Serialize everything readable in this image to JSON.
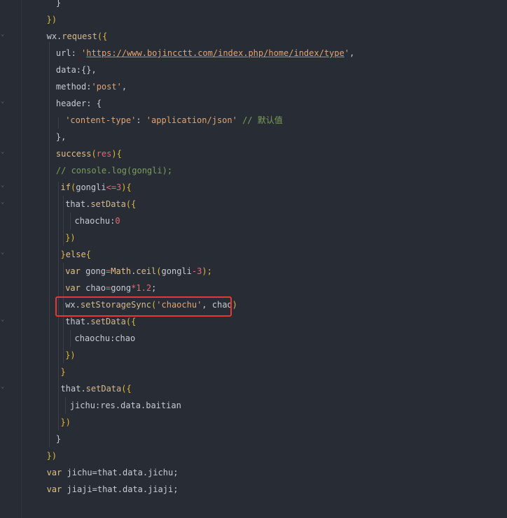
{
  "editor": {
    "language": "javascript",
    "highlight_color": "#e53935",
    "lines": [
      {
        "indent": 3,
        "tokens": [
          {
            "t": "}",
            "c": "pl"
          }
        ]
      },
      {
        "indent": 2,
        "tokens": [
          {
            "t": "})",
            "c": "br"
          }
        ]
      },
      {
        "indent": 2,
        "tokens": [
          {
            "t": "wx.",
            "c": "pl"
          },
          {
            "t": "request",
            "c": "fn"
          },
          {
            "t": "({",
            "c": "br"
          }
        ]
      },
      {
        "indent": 3,
        "tokens": [
          {
            "t": "url",
            "c": "pl"
          },
          {
            "t": ": ",
            "c": "pl"
          },
          {
            "t": "'",
            "c": "str"
          },
          {
            "t": "https://www.bojincctt.com/index.php/home/index/type",
            "c": "url"
          },
          {
            "t": "'",
            "c": "str"
          },
          {
            "t": ",",
            "c": "pl"
          }
        ]
      },
      {
        "indent": 3,
        "tokens": [
          {
            "t": "data",
            "c": "pl"
          },
          {
            "t": ":{},",
            "c": "pl"
          }
        ]
      },
      {
        "indent": 3,
        "tokens": [
          {
            "t": "method",
            "c": "pl"
          },
          {
            "t": ":",
            "c": "pl"
          },
          {
            "t": "'post'",
            "c": "str"
          },
          {
            "t": ",",
            "c": "pl"
          }
        ]
      },
      {
        "indent": 3,
        "tokens": [
          {
            "t": "header",
            "c": "pl"
          },
          {
            "t": ": {",
            "c": "pl"
          }
        ]
      },
      {
        "indent": 4,
        "tokens": [
          {
            "t": "'content-type'",
            "c": "str"
          },
          {
            "t": ": ",
            "c": "pl"
          },
          {
            "t": "'application/json'",
            "c": "str"
          },
          {
            "t": " ",
            "c": "pl"
          },
          {
            "t": "// 默认值",
            "c": "com"
          }
        ]
      },
      {
        "indent": 3,
        "tokens": [
          {
            "t": "},",
            "c": "pl"
          }
        ]
      },
      {
        "indent": 3,
        "tokens": [
          {
            "t": "success",
            "c": "kw"
          },
          {
            "t": "(",
            "c": "br"
          },
          {
            "t": "res",
            "c": "op"
          },
          {
            "t": "){",
            "c": "br"
          }
        ]
      },
      {
        "indent": 3,
        "tokens": [
          {
            "t": "// console.log(gongli);",
            "c": "com"
          }
        ]
      },
      {
        "indent": 3.5,
        "tokens": [
          {
            "t": "if",
            "c": "kw"
          },
          {
            "t": "(",
            "c": "br"
          },
          {
            "t": "gongli",
            "c": "pl"
          },
          {
            "t": "<=",
            "c": "op"
          },
          {
            "t": "3",
            "c": "num"
          },
          {
            "t": "){",
            "c": "br"
          }
        ]
      },
      {
        "indent": 4,
        "tokens": [
          {
            "t": "that.",
            "c": "pl"
          },
          {
            "t": "setData",
            "c": "fn"
          },
          {
            "t": "({",
            "c": "br"
          }
        ]
      },
      {
        "indent": 5,
        "tokens": [
          {
            "t": "chaochu",
            "c": "pl"
          },
          {
            "t": ":",
            "c": "pl"
          },
          {
            "t": "0",
            "c": "num"
          }
        ]
      },
      {
        "indent": 4,
        "tokens": [
          {
            "t": "})",
            "c": "br"
          }
        ]
      },
      {
        "indent": 3.5,
        "tokens": [
          {
            "t": "}",
            "c": "br"
          },
          {
            "t": "else",
            "c": "kw"
          },
          {
            "t": "{",
            "c": "br"
          }
        ]
      },
      {
        "indent": 4,
        "tokens": [
          {
            "t": "var",
            "c": "kw"
          },
          {
            "t": " gong",
            "c": "pl"
          },
          {
            "t": "=",
            "c": "op"
          },
          {
            "t": "Math",
            "c": "kw"
          },
          {
            "t": ".",
            "c": "pl"
          },
          {
            "t": "ceil",
            "c": "fn"
          },
          {
            "t": "(",
            "c": "br"
          },
          {
            "t": "gongli",
            "c": "pl"
          },
          {
            "t": "-",
            "c": "op"
          },
          {
            "t": "3",
            "c": "num"
          },
          {
            "t": ");",
            "c": "br"
          }
        ]
      },
      {
        "indent": 4,
        "tokens": [
          {
            "t": "var",
            "c": "kw"
          },
          {
            "t": " chao",
            "c": "pl"
          },
          {
            "t": "=",
            "c": "op"
          },
          {
            "t": "gong",
            "c": "pl"
          },
          {
            "t": "*",
            "c": "op"
          },
          {
            "t": "1.2",
            "c": "num"
          },
          {
            "t": ";",
            "c": "pl"
          }
        ]
      },
      {
        "indent": 4,
        "tokens": [
          {
            "t": "wx.",
            "c": "pl"
          },
          {
            "t": "setStorageSync",
            "c": "fn"
          },
          {
            "t": "(",
            "c": "br"
          },
          {
            "t": "'chaochu'",
            "c": "str"
          },
          {
            "t": ", chao",
            "c": "pl"
          },
          {
            "t": ")",
            "c": "br"
          }
        ]
      },
      {
        "indent": 4,
        "tokens": [
          {
            "t": "that.",
            "c": "pl"
          },
          {
            "t": "setData",
            "c": "fn"
          },
          {
            "t": "({",
            "c": "br"
          }
        ]
      },
      {
        "indent": 5,
        "tokens": [
          {
            "t": "chaochu",
            "c": "pl"
          },
          {
            "t": ":chao",
            "c": "pl"
          }
        ]
      },
      {
        "indent": 4,
        "tokens": [
          {
            "t": "})",
            "c": "br"
          }
        ]
      },
      {
        "indent": 3.5,
        "tokens": [
          {
            "t": "}",
            "c": "br"
          }
        ]
      },
      {
        "indent": 3.5,
        "tokens": [
          {
            "t": "that.",
            "c": "pl"
          },
          {
            "t": "setData",
            "c": "fn"
          },
          {
            "t": "({",
            "c": "br"
          }
        ]
      },
      {
        "indent": 4.5,
        "tokens": [
          {
            "t": "jichu",
            "c": "pl"
          },
          {
            "t": ":res.data.baitian",
            "c": "pl"
          }
        ]
      },
      {
        "indent": 3.5,
        "tokens": [
          {
            "t": "})",
            "c": "br"
          }
        ]
      },
      {
        "indent": 3,
        "tokens": [
          {
            "t": "}",
            "c": "pl"
          }
        ]
      },
      {
        "indent": 2,
        "tokens": [
          {
            "t": "})",
            "c": "br"
          }
        ]
      },
      {
        "indent": 2,
        "tokens": [
          {
            "t": "var",
            "c": "kw"
          },
          {
            "t": " jichu=that.data.jichu;",
            "c": "pl"
          }
        ]
      },
      {
        "indent": 2,
        "tokens": [
          {
            "t": "var",
            "c": "kw"
          },
          {
            "t": " jiaji=that.data.jiaji;",
            "c": "pl"
          }
        ]
      }
    ]
  }
}
